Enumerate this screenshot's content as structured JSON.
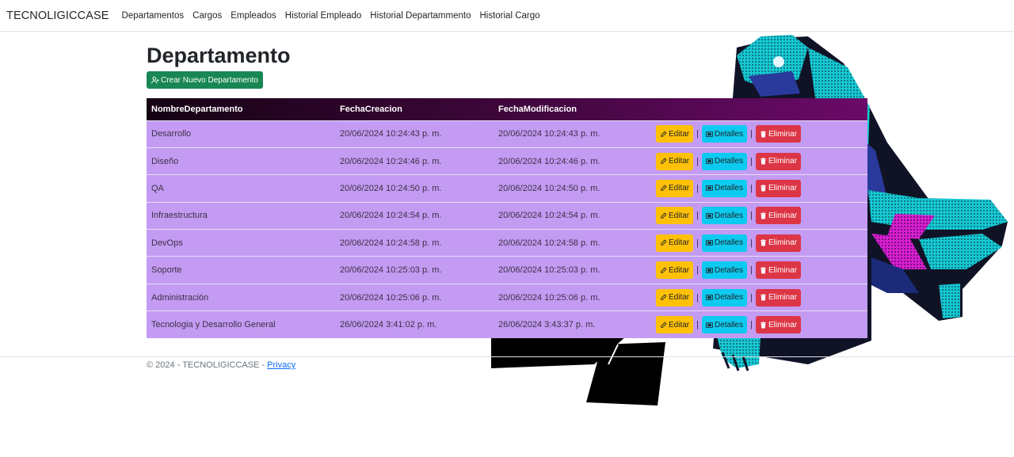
{
  "navbar": {
    "brand": "TECNOLIGICCASE",
    "links": [
      "Departamentos",
      "Cargos",
      "Empleados",
      "Historial Empleado",
      "Historial Departammento",
      "Historial Cargo"
    ]
  },
  "main": {
    "title": "Departamento",
    "create_button": "Crear Nuevo Departamento"
  },
  "table": {
    "headers": [
      "NombreDepartamento",
      "FechaCreacion",
      "FechaModificacion",
      ""
    ],
    "rows": [
      [
        "Desarrollo",
        "20/06/2024 10:24:43 p. m.",
        "20/06/2024 10:24:43 p. m."
      ],
      [
        "Diseño",
        "20/06/2024 10:24:46 p. m.",
        "20/06/2024 10:24:46 p. m."
      ],
      [
        "QA",
        "20/06/2024 10:24:50 p. m.",
        "20/06/2024 10:24:50 p. m."
      ],
      [
        "Infraestructura",
        "20/06/2024 10:24:54 p. m.",
        "20/06/2024 10:24:54 p. m."
      ],
      [
        "DevOps",
        "20/06/2024 10:24:58 p. m.",
        "20/06/2024 10:24:58 p. m."
      ],
      [
        "Soporte",
        "20/06/2024 10:25:03 p. m.",
        "20/06/2024 10:25:03 p. m."
      ],
      [
        "Administración",
        "20/06/2024 10:25:06 p. m.",
        "20/06/2024 10:25:06 p. m."
      ],
      [
        "Tecnologia y Desarrollo General",
        "26/06/2024 3:41:02 p. m.",
        "26/06/2024 3:43:37 p. m."
      ]
    ],
    "actions": {
      "edit": "Editar",
      "details": "Detalles",
      "delete": "Eliminar",
      "separator": "|"
    }
  },
  "footer": {
    "text": "© 2024 - TECNOLIGICCASE - ",
    "privacy_link": "Privacy"
  },
  "colors": {
    "create": "#198754",
    "edit": "#ffc107",
    "details": "#0dcaf0",
    "delete": "#dc3545",
    "row_bg": "#c39bf2",
    "header_start": "#150213",
    "header_end": "#6b0a68",
    "figure_cyan": "#19e6e6",
    "figure_magenta": "#e61fd6",
    "figure_blue": "#2a3a9c"
  },
  "icons": {
    "create": "person-add-icon",
    "edit": "pencil-icon",
    "details": "list-icon",
    "delete": "trash-icon"
  }
}
